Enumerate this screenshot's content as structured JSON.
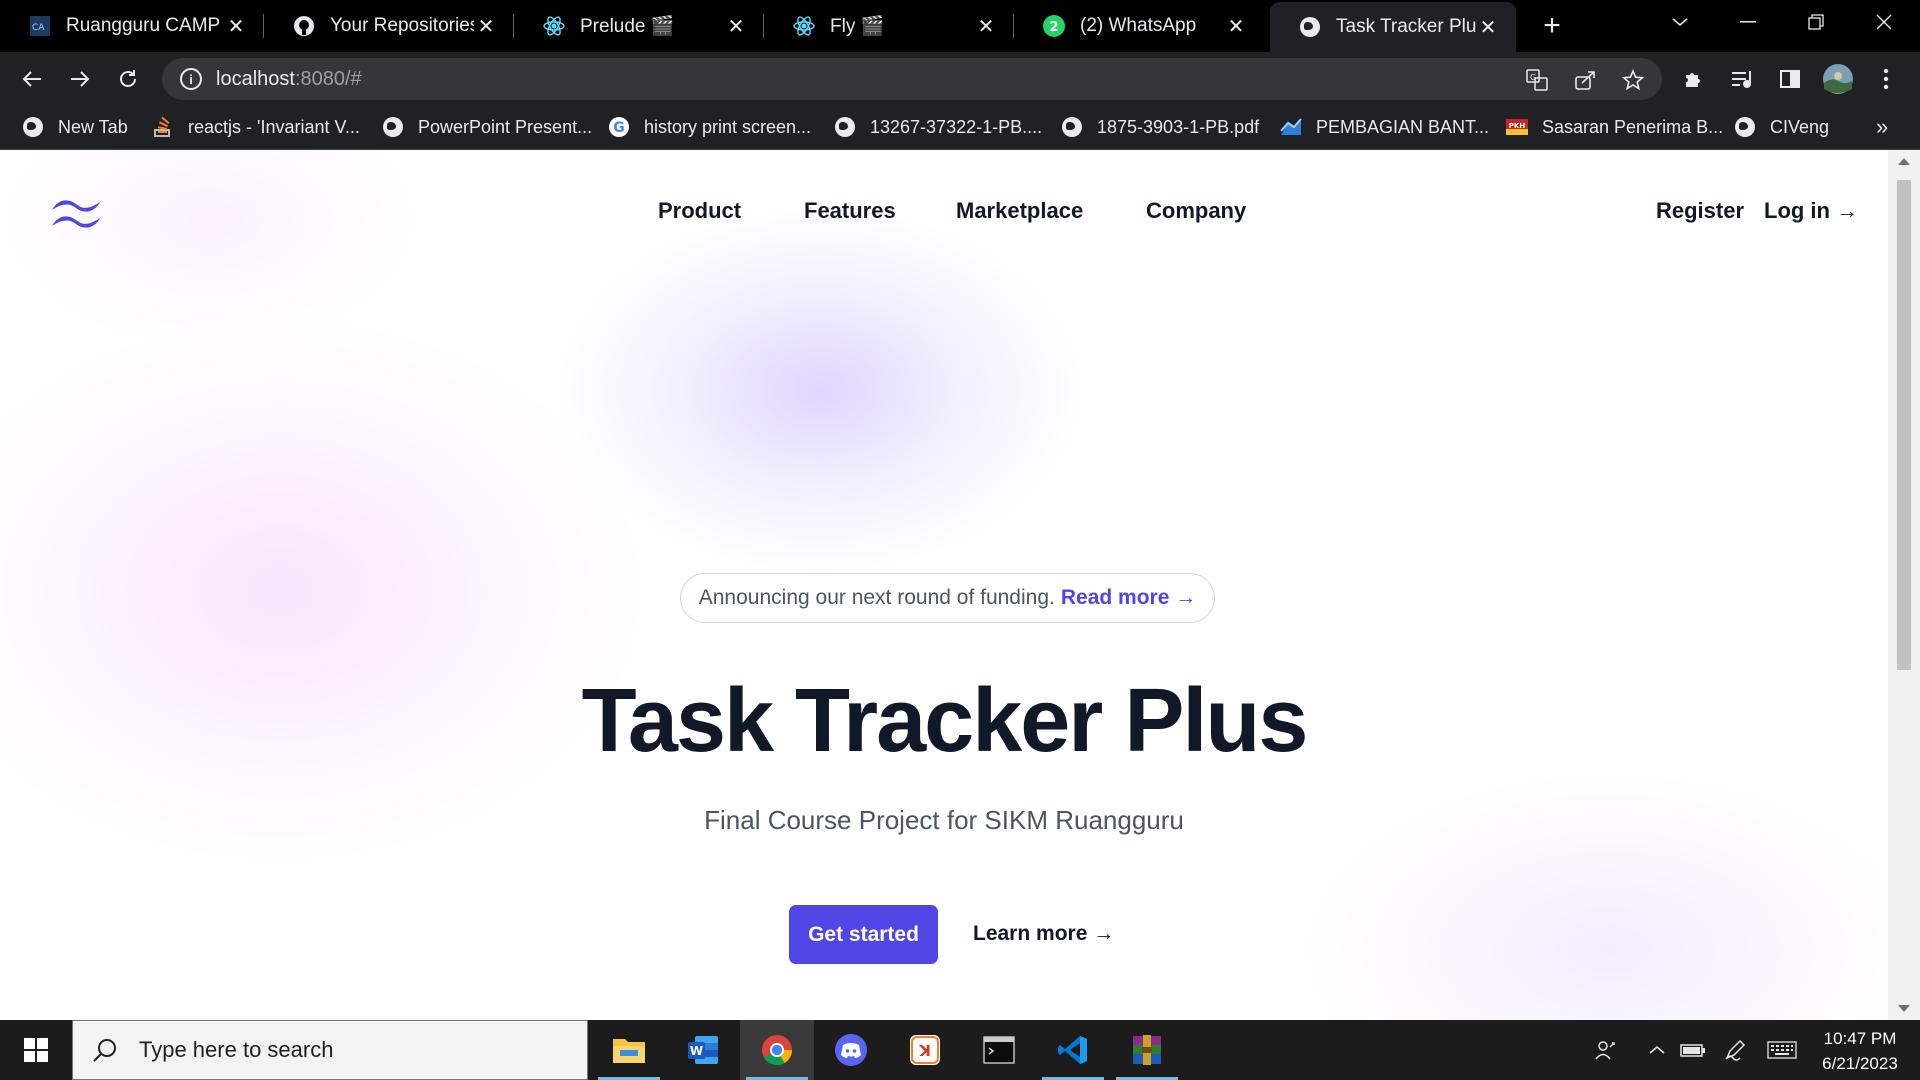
{
  "browser": {
    "tabs": [
      {
        "title": "Ruangguru CAMP",
        "favicon": "ruangguru-camp-favicon"
      },
      {
        "title": "Your Repositories",
        "favicon": "github-icon"
      },
      {
        "title": "Prelude 🎬",
        "favicon": "react-icon"
      },
      {
        "title": "Fly 🎬",
        "favicon": "react-icon"
      },
      {
        "title": "(2) WhatsApp",
        "favicon": "whatsapp-icon",
        "badge": "2"
      },
      {
        "title": "Task Tracker Plus",
        "favicon": "globe-icon",
        "active": true
      }
    ],
    "address": {
      "host": "localhost",
      "rest": ":8080/#"
    },
    "bookmarks": [
      {
        "label": "New Tab",
        "icon": "globe-icon"
      },
      {
        "label": "reactjs - 'Invariant V...",
        "icon": "stackoverflow-icon"
      },
      {
        "label": "PowerPoint Present...",
        "icon": "globe-icon"
      },
      {
        "label": "history print screen...",
        "icon": "google-icon"
      },
      {
        "label": "13267-37322-1-PB....",
        "icon": "globe-icon"
      },
      {
        "label": "1875-3903-1-PB.pdf",
        "icon": "globe-icon"
      },
      {
        "label": "PEMBAGIAN BANT...",
        "icon": "chart-icon"
      },
      {
        "label": "Sasaran Penerima B...",
        "icon": "pkh-icon"
      },
      {
        "label": "CIVeng",
        "icon": "globe-icon"
      }
    ],
    "bookmarks_more": "»"
  },
  "page": {
    "nav": [
      "Product",
      "Features",
      "Marketplace",
      "Company"
    ],
    "register": "Register",
    "login": "Log in →",
    "announcement": {
      "text": "Announcing our next round of funding.",
      "link": "Read more →"
    },
    "title": "Task Tracker Plus",
    "subtitle": "Final Course Project for SIKM Ruangguru",
    "cta_primary": "Get started",
    "cta_secondary": "Learn more →",
    "colors": {
      "accent": "#4f46e5",
      "heading": "#111827",
      "body": "#4b5563"
    }
  },
  "taskbar": {
    "search_placeholder": "Type here to search",
    "apps": [
      "file-explorer-icon",
      "word-icon",
      "chrome-icon",
      "discord-icon",
      "xampp-icon",
      "terminal-icon",
      "vscode-icon",
      "winrar-icon"
    ],
    "time": "10:47 PM",
    "date": "6/21/2023"
  }
}
